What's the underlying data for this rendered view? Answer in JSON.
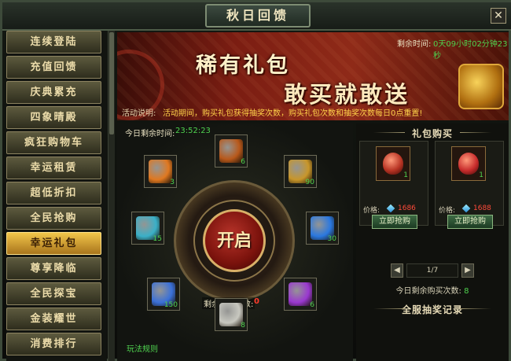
{
  "window": {
    "title": "秋日回馈",
    "close_label": "✕"
  },
  "sidebar": {
    "items": [
      {
        "label": "连续登陆",
        "active": false
      },
      {
        "label": "充值回馈",
        "active": false
      },
      {
        "label": "庆典累充",
        "active": false
      },
      {
        "label": "四象晴殿",
        "active": false
      },
      {
        "label": "疯狂购物车",
        "active": false
      },
      {
        "label": "幸运租赁",
        "active": false
      },
      {
        "label": "超低折扣",
        "active": false
      },
      {
        "label": "全民抢购",
        "active": false
      },
      {
        "label": "幸运礼包",
        "active": true
      },
      {
        "label": "尊享降临",
        "active": false
      },
      {
        "label": "全民探宝",
        "active": false
      },
      {
        "label": "金装耀世",
        "active": false
      },
      {
        "label": "消费排行",
        "active": false
      }
    ]
  },
  "banner": {
    "title_line1": "稀有礼包",
    "title_line2": "敢买就敢送",
    "remaining_label": "剩余时间:",
    "remaining_value": "0天09小时02分钟23秒",
    "desc_label": "活动说明:",
    "desc_text": "活动期间，购买礼包获得抽奖次数，购买礼包次数和抽奖次数每日0点重置!"
  },
  "lottery": {
    "countdown_label": "今日剩余时间:",
    "countdown_value": "23:52:23",
    "open_button": "开启",
    "draws_label": "剩余抽奖次数:",
    "draws_value": "0",
    "rules_link": "玩法规则",
    "items": [
      {
        "name": "orange-crystal-icon",
        "count": "3",
        "color": "#e07820"
      },
      {
        "name": "treasure-chest-icon",
        "count": "6",
        "color": "#b8581a"
      },
      {
        "name": "golden-chest-icon",
        "count": "90",
        "color": "#c8962a"
      },
      {
        "name": "rainbow-gem-icon",
        "count": "15",
        "color": "#3ab0c8"
      },
      {
        "name": "blue-rune-icon",
        "count": "30",
        "color": "#2a78e0"
      },
      {
        "name": "blue-crystal-icon",
        "count": "150",
        "color": "#3a70d8"
      },
      {
        "name": "purple-gem-icon",
        "count": "6",
        "color": "#9a38d0"
      },
      {
        "name": "silver-feather-icon",
        "count": "8",
        "color": "#c8c8c0"
      }
    ]
  },
  "shop": {
    "title": "礼包购买",
    "packages": [
      {
        "name": "red-gift-bag-icon",
        "count": "1",
        "price_label": "价格:",
        "price": "1686",
        "buy_label": "立即抢购",
        "color": "#b83424"
      },
      {
        "name": "red-gift-box-icon",
        "count": "1",
        "price_label": "价格:",
        "price": "1688",
        "buy_label": "立即抢购",
        "color": "#c82c2c"
      }
    ],
    "page_display": "1/7",
    "prev_label": "◀",
    "next_label": "▶",
    "today_buy_label": "今日剩余购买次数:",
    "today_buy_value": "8",
    "record_title": "全服抽奖记录"
  }
}
